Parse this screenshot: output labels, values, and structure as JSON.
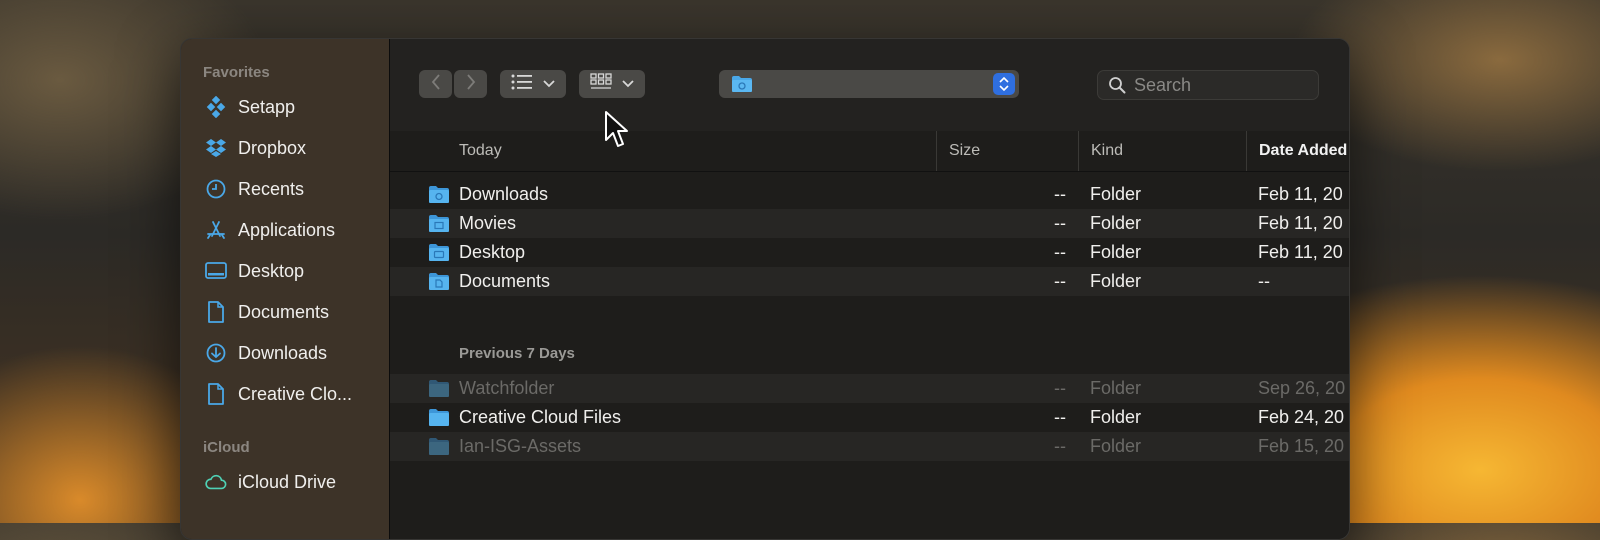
{
  "sidebar": {
    "favorites_label": "Favorites",
    "items": [
      {
        "label": "Setapp",
        "icon": "setapp-icon"
      },
      {
        "label": "Dropbox",
        "icon": "dropbox-icon"
      },
      {
        "label": "Recents",
        "icon": "clock-icon"
      },
      {
        "label": "Applications",
        "icon": "applications-icon"
      },
      {
        "label": "Desktop",
        "icon": "desktop-icon"
      },
      {
        "label": "Documents",
        "icon": "document-icon"
      },
      {
        "label": "Downloads",
        "icon": "download-icon"
      },
      {
        "label": "Creative Clo...",
        "icon": "document-icon"
      }
    ],
    "icloud_label": "iCloud",
    "icloud_items": [
      {
        "label": "iCloud Drive",
        "icon": "cloud-icon"
      }
    ]
  },
  "toolbar": {
    "search_placeholder": "Search"
  },
  "columns": {
    "name": "Today",
    "size": "Size",
    "kind": "Kind",
    "date": "Date Added"
  },
  "groups": {
    "today": "Today",
    "previous": "Previous 7 Days"
  },
  "today_rows": [
    {
      "name": "Downloads",
      "size": "--",
      "kind": "Folder",
      "date": "Feb 11, 20"
    },
    {
      "name": "Movies",
      "size": "--",
      "kind": "Folder",
      "date": "Feb 11, 20"
    },
    {
      "name": "Desktop",
      "size": "--",
      "kind": "Folder",
      "date": "Feb 11, 20"
    },
    {
      "name": "Documents",
      "size": "--",
      "kind": "Folder",
      "date": "--"
    }
  ],
  "previous_rows": [
    {
      "name": "Watchfolder",
      "size": "--",
      "kind": "Folder",
      "date": "Sep 26, 20",
      "dim": true
    },
    {
      "name": "Creative Cloud Files",
      "size": "--",
      "kind": "Folder",
      "date": "Feb 24, 20",
      "dim": false
    },
    {
      "name": "Ian-ISG-Assets",
      "size": "--",
      "kind": "Folder",
      "date": "Feb 15, 20",
      "dim": true
    }
  ],
  "colors": {
    "accent": "#3d8bfd",
    "folder": "#4aa8e8",
    "icloud": "#4fd1b5"
  }
}
